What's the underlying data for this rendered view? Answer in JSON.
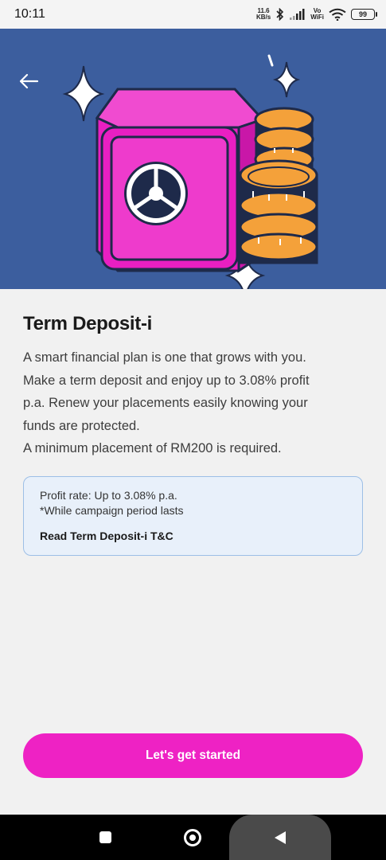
{
  "status_bar": {
    "time": "10:11",
    "speed_value": "11.6",
    "speed_unit": "KB/s",
    "vo_label": "Vo",
    "wifi_label": "WiFi",
    "battery": "99"
  },
  "hero": {
    "background_color": "#3c5e9e",
    "illustration": "safe-with-coins"
  },
  "content": {
    "title": "Term Deposit-i",
    "description_lines": [
      "A smart financial plan is one that grows with you.",
      "Make a term deposit and enjoy up to 3.08% profit",
      "p.a. Renew your placements easily knowing your",
      "funds are protected.",
      "A minimum placement of RM200 is required."
    ],
    "info_box": {
      "profit_rate": "Profit rate: Up to 3.08% p.a.",
      "note": "*While campaign period lasts",
      "tnc_link": "Read Term Deposit-i T&C"
    }
  },
  "footer": {
    "cta_label": "Let's get started",
    "cta_color": "#ee22c4"
  },
  "nav_bar": {
    "icons": [
      "recents-square-icon",
      "home-circle-icon",
      "back-triangle-icon"
    ]
  }
}
